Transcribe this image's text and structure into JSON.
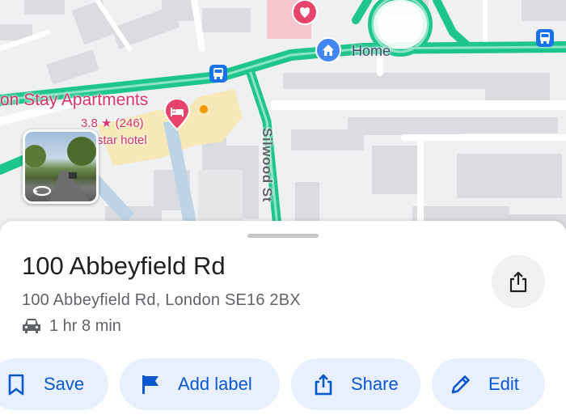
{
  "map": {
    "hotel_name": "on Stay Apartments",
    "hotel_rating": "3.8 ★ (246)",
    "hotel_type": "star hotel",
    "home_label": "Home",
    "street_label": "Silwood St"
  },
  "place": {
    "title": "100 Abbeyfield Rd",
    "address": "100 Abbeyfield Rd, London SE16 2BX",
    "travel_time": "1 hr 8 min"
  },
  "actions": {
    "save": "Save",
    "add_label": "Add label",
    "share": "Share",
    "edit": "Edit"
  },
  "colors": {
    "accent": "#0b57d0",
    "chip_bg": "#e8f0fe",
    "route_green": "#1ec58c",
    "poi_pink": "#d6336c"
  },
  "icons": [
    "bookmark-icon",
    "flag-icon",
    "share-icon",
    "pencil-icon",
    "car-icon",
    "home-icon",
    "bed-icon",
    "heart-icon",
    "bus-stop-icon",
    "street-view-rotate-icon"
  ]
}
